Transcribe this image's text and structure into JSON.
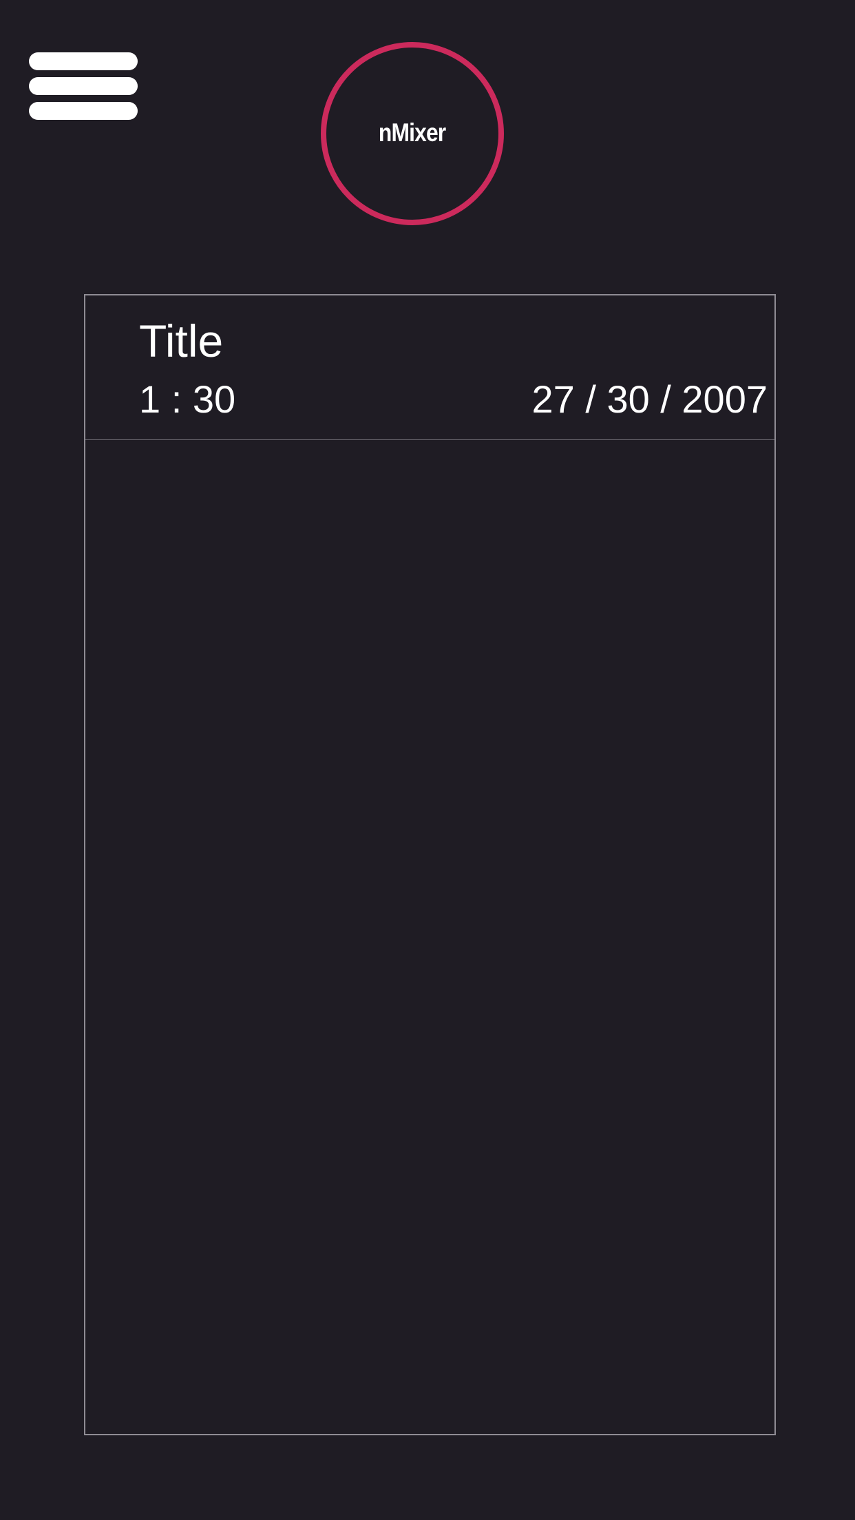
{
  "app": {
    "logo_text": "nMixer",
    "accent_color": "#cc2a5c",
    "background_color": "#1f1c24"
  },
  "header": {
    "menu_icon": "hamburger-menu-icon"
  },
  "card": {
    "title": "Title",
    "duration": "1 : 30",
    "date": "27 / 30 / 2007"
  }
}
